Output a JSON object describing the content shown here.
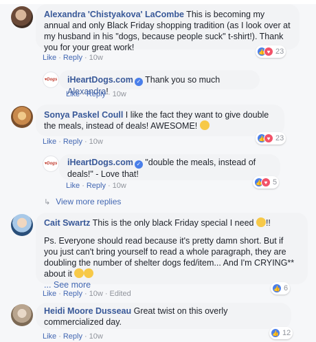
{
  "colors": {
    "link_blue": "#385898",
    "action_blue": "#4267b2",
    "meta_grey": "#90949c",
    "bubble_bg": "#f2f3f5",
    "like_blue": "#4a7fea",
    "love_red": "#f25268"
  },
  "actions": {
    "like": "Like",
    "reply": "Reply",
    "sep": "·"
  },
  "comments": [
    {
      "author": "Alexandra 'Chistyakova' LaCombe",
      "text": " This is becoming my annual and only Black Friday shopping tradition (as I look over at my husband in his \"dogs, because people suck\" t-shirt!). Thank you for your great work!",
      "time": "10w",
      "reaction_count": "23"
    },
    {
      "author": "iHeartDogs.com",
      "text": " Thank you so much ",
      "mention": "Alexandra",
      "suffix": "!",
      "time": "10w",
      "avatar_label": "iHeartDogs"
    },
    {
      "author": "Sonya Paskel Coull",
      "text": " I like the fact they want to give double the meals, instead of deals! AWESOME! ",
      "time": "10w",
      "reaction_count": "23"
    },
    {
      "author": "iHeartDogs.com",
      "text": " \"double the meals, instead of deals!\" - Love that!",
      "time": "10w",
      "reaction_count": "5",
      "avatar_label": "iHeartDogs"
    },
    {
      "author": "Cait Swartz",
      "text": " This is the only black Friday special I need ",
      "suffix": "!!",
      "text2": "Ps. Everyone should read because it's pretty damn short. But if you just can't bring yourself to read a whole paragraph, they are doubling the number of shelter dogs fed/item... And I'm CRYING** about it ",
      "see_more": "... See more",
      "time": "10w",
      "edited": "Edited",
      "reaction_count": "6"
    },
    {
      "author": "Heidi Moore Dusseau",
      "text": " Great twist on this overly commercialized day.",
      "time": "10w",
      "reaction_count": "12"
    }
  ],
  "view_more_replies": "View more replies",
  "icons": {
    "verified": "verified-badge-icon",
    "like": "like-reaction-icon",
    "love": "love-reaction-icon",
    "reply_arrow": "reply-arrow-icon"
  }
}
